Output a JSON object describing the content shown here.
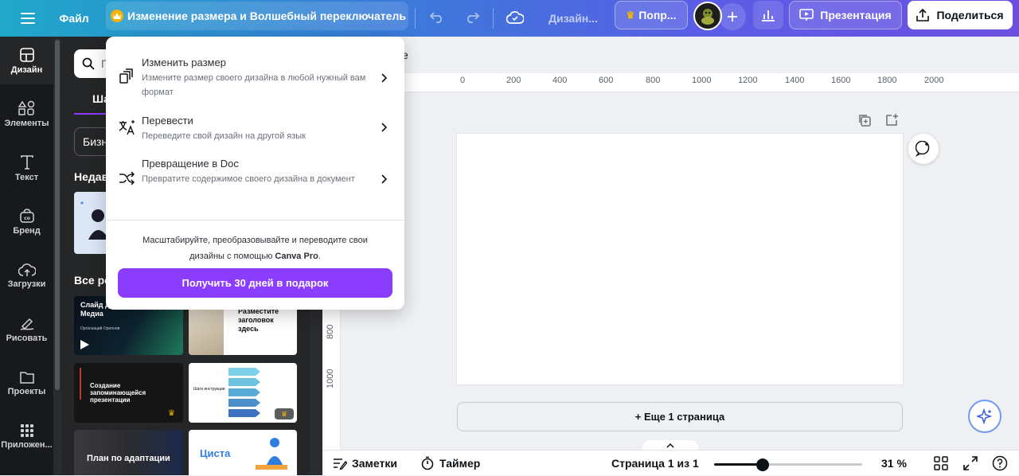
{
  "topbar": {
    "menu_icon": "hamburger-icon",
    "file_label": "Файл",
    "title": "Изменение размера и Волшебный переключатель",
    "design_label": "Дизайн...",
    "try_pro_label": "Попр...",
    "presentation_label": "Презентация",
    "share_label": "Поделиться"
  },
  "rail": {
    "items": [
      {
        "label": "Дизайн",
        "icon": "layout-icon"
      },
      {
        "label": "Элементы",
        "icon": "shapes-icon"
      },
      {
        "label": "Текст",
        "icon": "text-icon"
      },
      {
        "label": "Бренд",
        "icon": "brand-icon"
      },
      {
        "label": "Загрузки",
        "icon": "upload-cloud-icon"
      },
      {
        "label": "Рисовать",
        "icon": "draw-icon"
      },
      {
        "label": "Проекты",
        "icon": "folder-icon"
      },
      {
        "label": "Приложен...",
        "icon": "apps-grid-icon"
      }
    ]
  },
  "panel": {
    "search_placeholder_fragment": "П",
    "tab_fragment": "Ша",
    "filter_fragment": "Бизн",
    "recent_heading_fragment": "Недав",
    "all_heading_fragment": "Все ре",
    "templates": [
      {
        "title": "Слайд для Игровых Медиа",
        "subtitle": "Оргонзаций Ореонов"
      },
      {
        "title": "Разместите заголовок здесь"
      },
      {
        "title": "Создание запоминающейся презентации"
      },
      {
        "title": "Шаги инструкции"
      },
      {
        "title": "План по адаптации"
      },
      {
        "title": "Циста"
      }
    ]
  },
  "canvas": {
    "header_fragment": "е",
    "ruler_top": [
      "0",
      "200",
      "400",
      "600",
      "800",
      "1000",
      "1200",
      "1400",
      "1600",
      "1800",
      "2000"
    ],
    "ruler_left": [
      "800",
      "1000"
    ],
    "more_pages_label": "+ Еще 1 страница"
  },
  "bottombar": {
    "notes_label": "Заметки",
    "timer_label": "Таймер",
    "page_indicator": "Страница 1 из 1",
    "zoom_label": "31 %",
    "zoom_fraction": 0.31
  },
  "dropdown": {
    "items": [
      {
        "title": "Изменить размер",
        "desc": "Измените размер своего дизайна в любой нужный вам формат",
        "icon": "resize-icon"
      },
      {
        "title": "Перевести",
        "desc": "Переведите свой дизайн на другой язык",
        "icon": "translate-icon"
      },
      {
        "title": "Превращение в Doc",
        "desc": "Превратите содержимое своего дизайна в документ",
        "icon": "shuffle-icon"
      }
    ],
    "promo_text_1": "Масштабируйте, преобразовывайте и переводите свои дизайны с помощью ",
    "promo_brand": "Canva Pro",
    "promo_text_2": ".",
    "cta_label": "Получить 30 дней в подарок"
  },
  "colors": {
    "accent": "#7d2ae8",
    "cta": "#8b3dff",
    "rail_bg": "#18191b",
    "panel_bg": "#252627"
  }
}
